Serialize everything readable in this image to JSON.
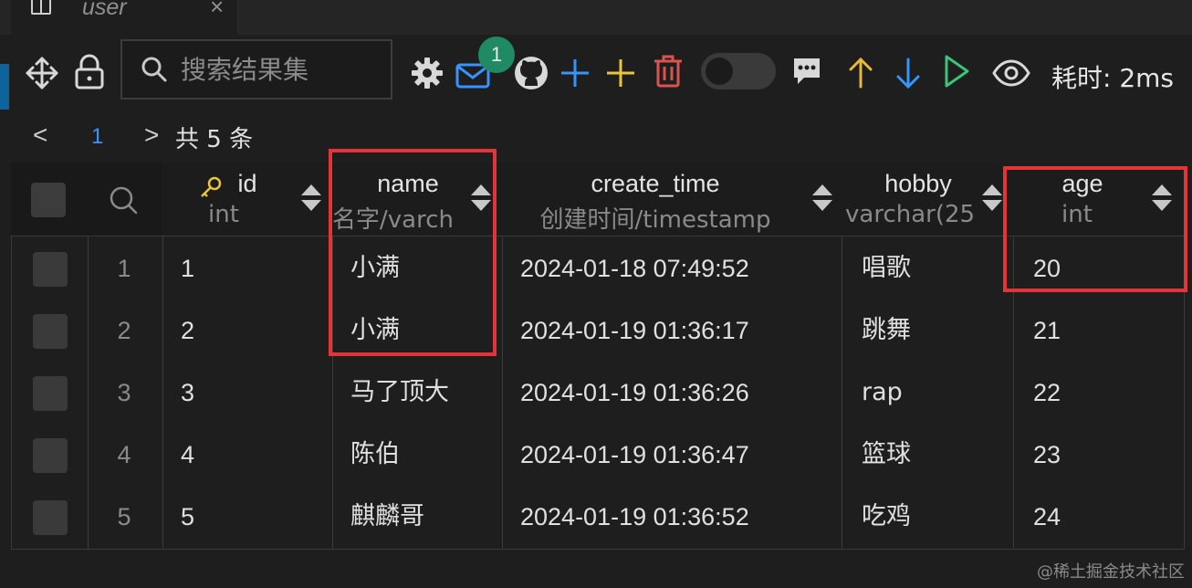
{
  "tab": {
    "title": "user",
    "close_glyph": "×"
  },
  "toolbar": {
    "search_placeholder": "搜索结果集",
    "mail_badge": "1",
    "elapsed": "耗时: 2ms",
    "icons": [
      "move-icon",
      "lock-icon",
      "search-icon",
      "gear-icon",
      "mail-icon",
      "github-icon",
      "plus-blue-icon",
      "plus-yellow-icon",
      "trash-icon",
      "toggle",
      "comment-icon",
      "arrow-up-icon",
      "arrow-down-icon",
      "play-icon",
      "eye-icon"
    ],
    "colors": {
      "plus_blue": "#3794ff",
      "plus_yellow": "#e8c53a",
      "trash": "#d9534f",
      "arrow_up": "#e8b83a",
      "arrow_down": "#3794ff",
      "play": "#3bc47a",
      "badge": "#1f8a64"
    }
  },
  "pager": {
    "prev": "<",
    "page": "1",
    "next": ">",
    "total": "共 5 条"
  },
  "columns": [
    {
      "name": "id",
      "type": "int"
    },
    {
      "name": "name",
      "type": "名字/varch"
    },
    {
      "name": "create_time",
      "type": "创建时间/timestamp"
    },
    {
      "name": "hobby",
      "type": "varchar(25"
    },
    {
      "name": "age",
      "type": "int"
    }
  ],
  "rows": [
    {
      "num": "1",
      "id": "1",
      "name": "小满",
      "create_time": "2024-01-18 07:49:52",
      "hobby": "唱歌",
      "age": "20"
    },
    {
      "num": "2",
      "id": "2",
      "name": "小满",
      "create_time": "2024-01-19 01:36:17",
      "hobby": "跳舞",
      "age": "21"
    },
    {
      "num": "3",
      "id": "3",
      "name": "马了顶大",
      "create_time": "2024-01-19 01:36:26",
      "hobby": "rap",
      "age": "22"
    },
    {
      "num": "4",
      "id": "4",
      "name": "陈伯",
      "create_time": "2024-01-19 01:36:47",
      "hobby": "篮球",
      "age": "23"
    },
    {
      "num": "5",
      "id": "5",
      "name": "麒麟哥",
      "create_time": "2024-01-19 01:36:52",
      "hobby": "吃鸡",
      "age": "24"
    }
  ],
  "highlight_color": "#e5333a",
  "watermark": "@稀土掘金技术社区"
}
